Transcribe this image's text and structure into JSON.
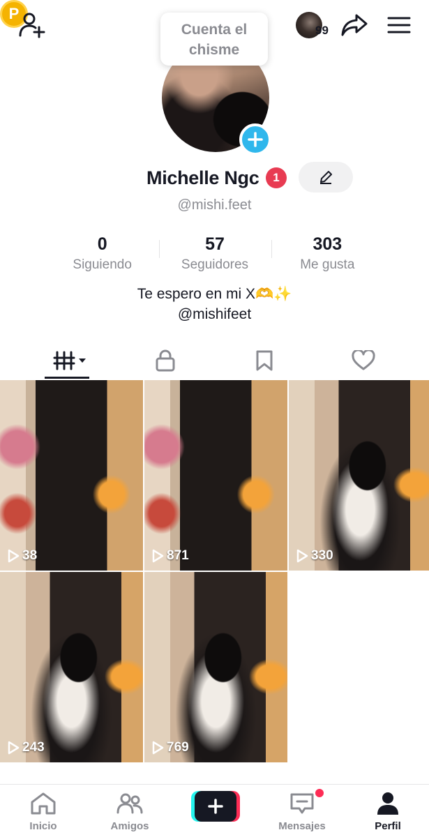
{
  "header": {
    "tooltip_text": "Cuenta el chisme",
    "coin_letter": "P",
    "inbox_count": "99"
  },
  "profile": {
    "display_name": "Michelle Ngc",
    "notification_count": "1",
    "username": "@mishi.feet",
    "bio_line1": "Te espero en mi X🫶✨",
    "bio_line2": "@mishifeet"
  },
  "stats": [
    {
      "value": "0",
      "label": "Siguiendo"
    },
    {
      "value": "57",
      "label": "Seguidores"
    },
    {
      "value": "303",
      "label": "Me gusta"
    }
  ],
  "tabs": [
    "videos-grid-icon",
    "lock-icon",
    "bookmark-icon",
    "heart-icon"
  ],
  "videos": [
    {
      "views": "38"
    },
    {
      "views": "871"
    },
    {
      "views": "330"
    },
    {
      "views": "243"
    },
    {
      "views": "769"
    }
  ],
  "bottom_nav": {
    "home": "Inicio",
    "friends": "Amigos",
    "messages": "Mensajes",
    "profile": "Perfil"
  },
  "colors": {
    "accent_red": "#fe2c55",
    "accent_cyan": "#25f4ee",
    "add_blue": "#2fb7ec",
    "text_primary": "#161823",
    "text_secondary": "#8a8b91"
  }
}
